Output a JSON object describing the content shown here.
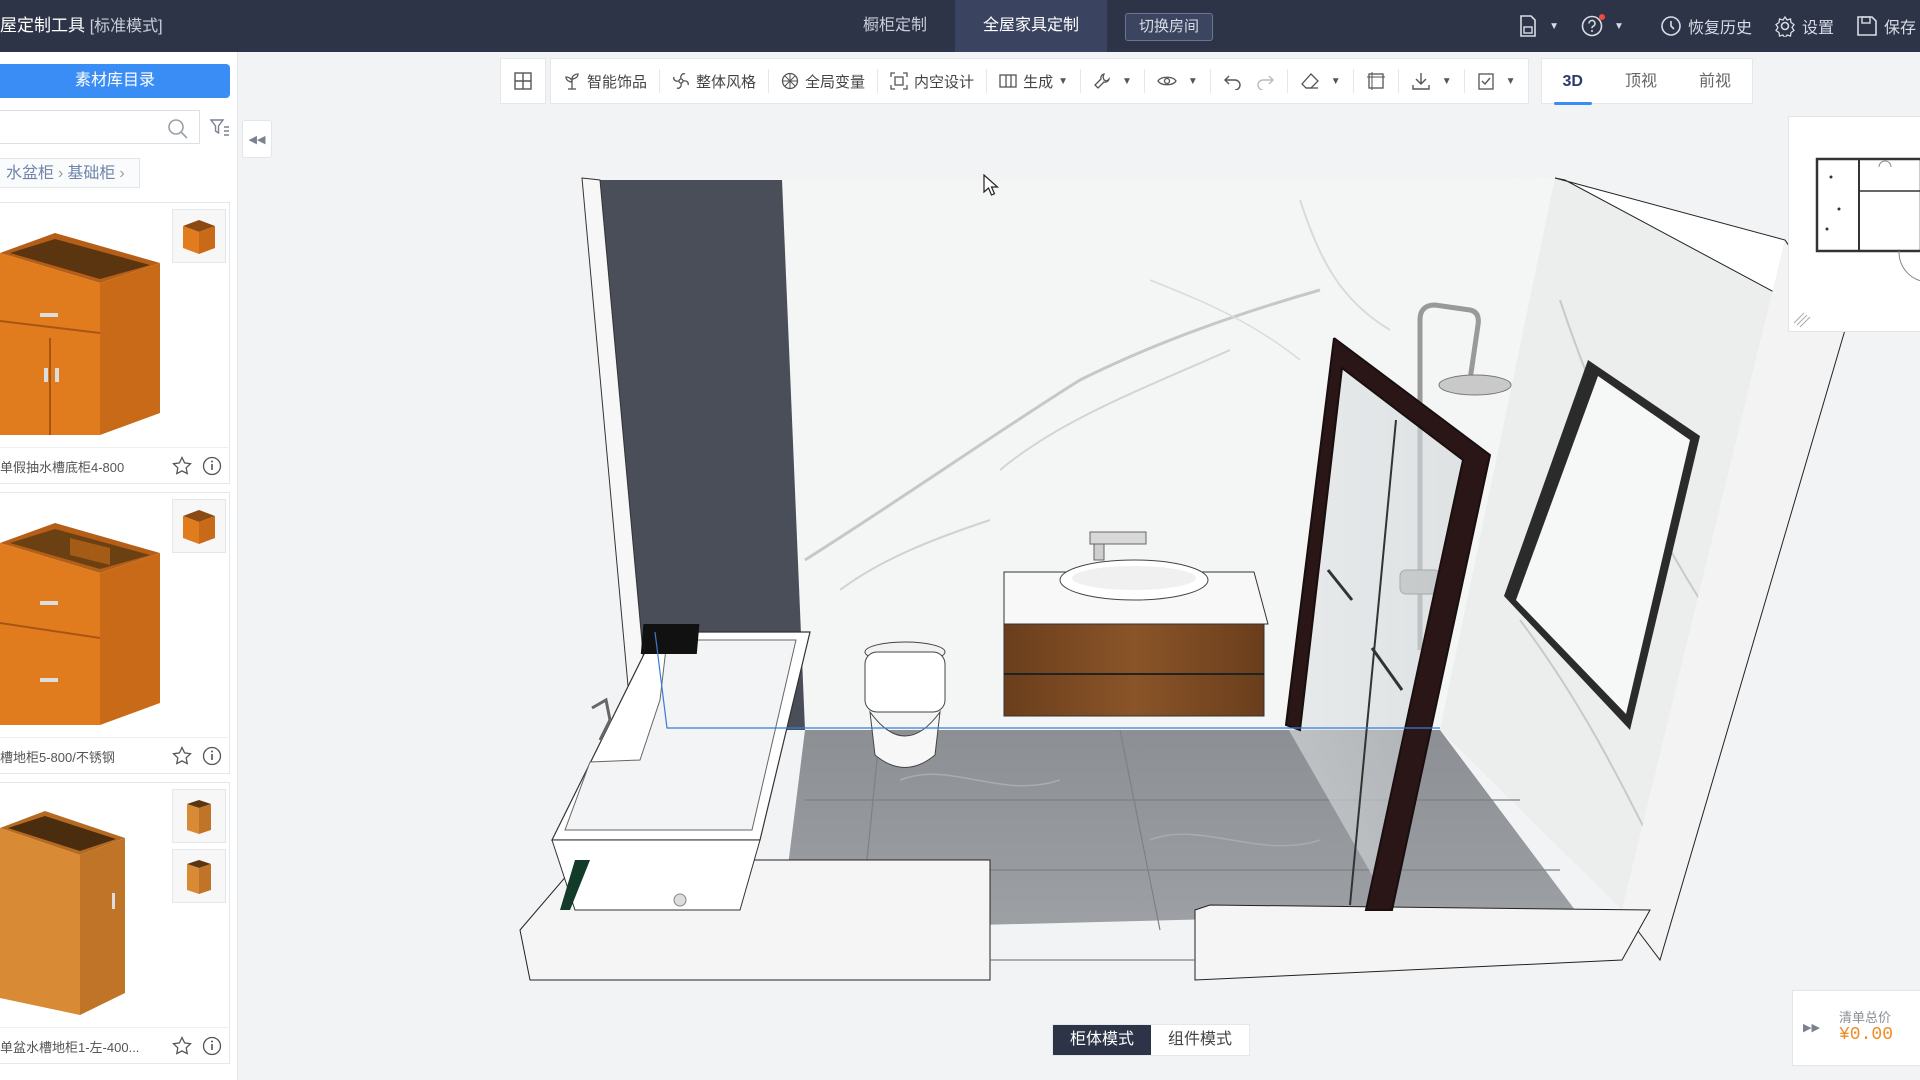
{
  "app": {
    "title": "屋定制工具",
    "mode": "[标准模式]"
  },
  "top_tabs": [
    {
      "label": "橱柜定制",
      "active": false
    },
    {
      "label": "全屋家具定制",
      "active": true
    }
  ],
  "switch_room_label": "切换房间",
  "top_right": {
    "restore_history": "恢复历史",
    "settings": "设置",
    "save": "保存"
  },
  "left_panel": {
    "library_button": "素材库目录",
    "search": {
      "value": "",
      "placeholder": ""
    },
    "breadcrumb": [
      "水盆柜",
      "基础柜"
    ],
    "items": [
      {
        "name": "单假抽水槽底柜4-800"
      },
      {
        "name": "槽地柜5-800/不锈钢"
      },
      {
        "name": "单盆水槽地柜1-左-400..."
      }
    ]
  },
  "toolbar": {
    "smart_decor": "智能饰品",
    "overall_style": "整体风格",
    "global_var": "全局变量",
    "hollow_design": "内空设计",
    "generate": "生成"
  },
  "view_tabs": [
    {
      "label": "3D",
      "active": true
    },
    {
      "label": "顶视",
      "active": false
    },
    {
      "label": "前视",
      "active": false
    }
  ],
  "mode_toggle": [
    {
      "label": "柜体模式",
      "active": true
    },
    {
      "label": "组件模式",
      "active": false
    }
  ],
  "price": {
    "label": "清单总价",
    "value": "¥0.00"
  },
  "colors": {
    "topbar": "#2d3447",
    "accent": "#3a8df5",
    "price": "#f08c24",
    "wood": "#d9791f"
  }
}
